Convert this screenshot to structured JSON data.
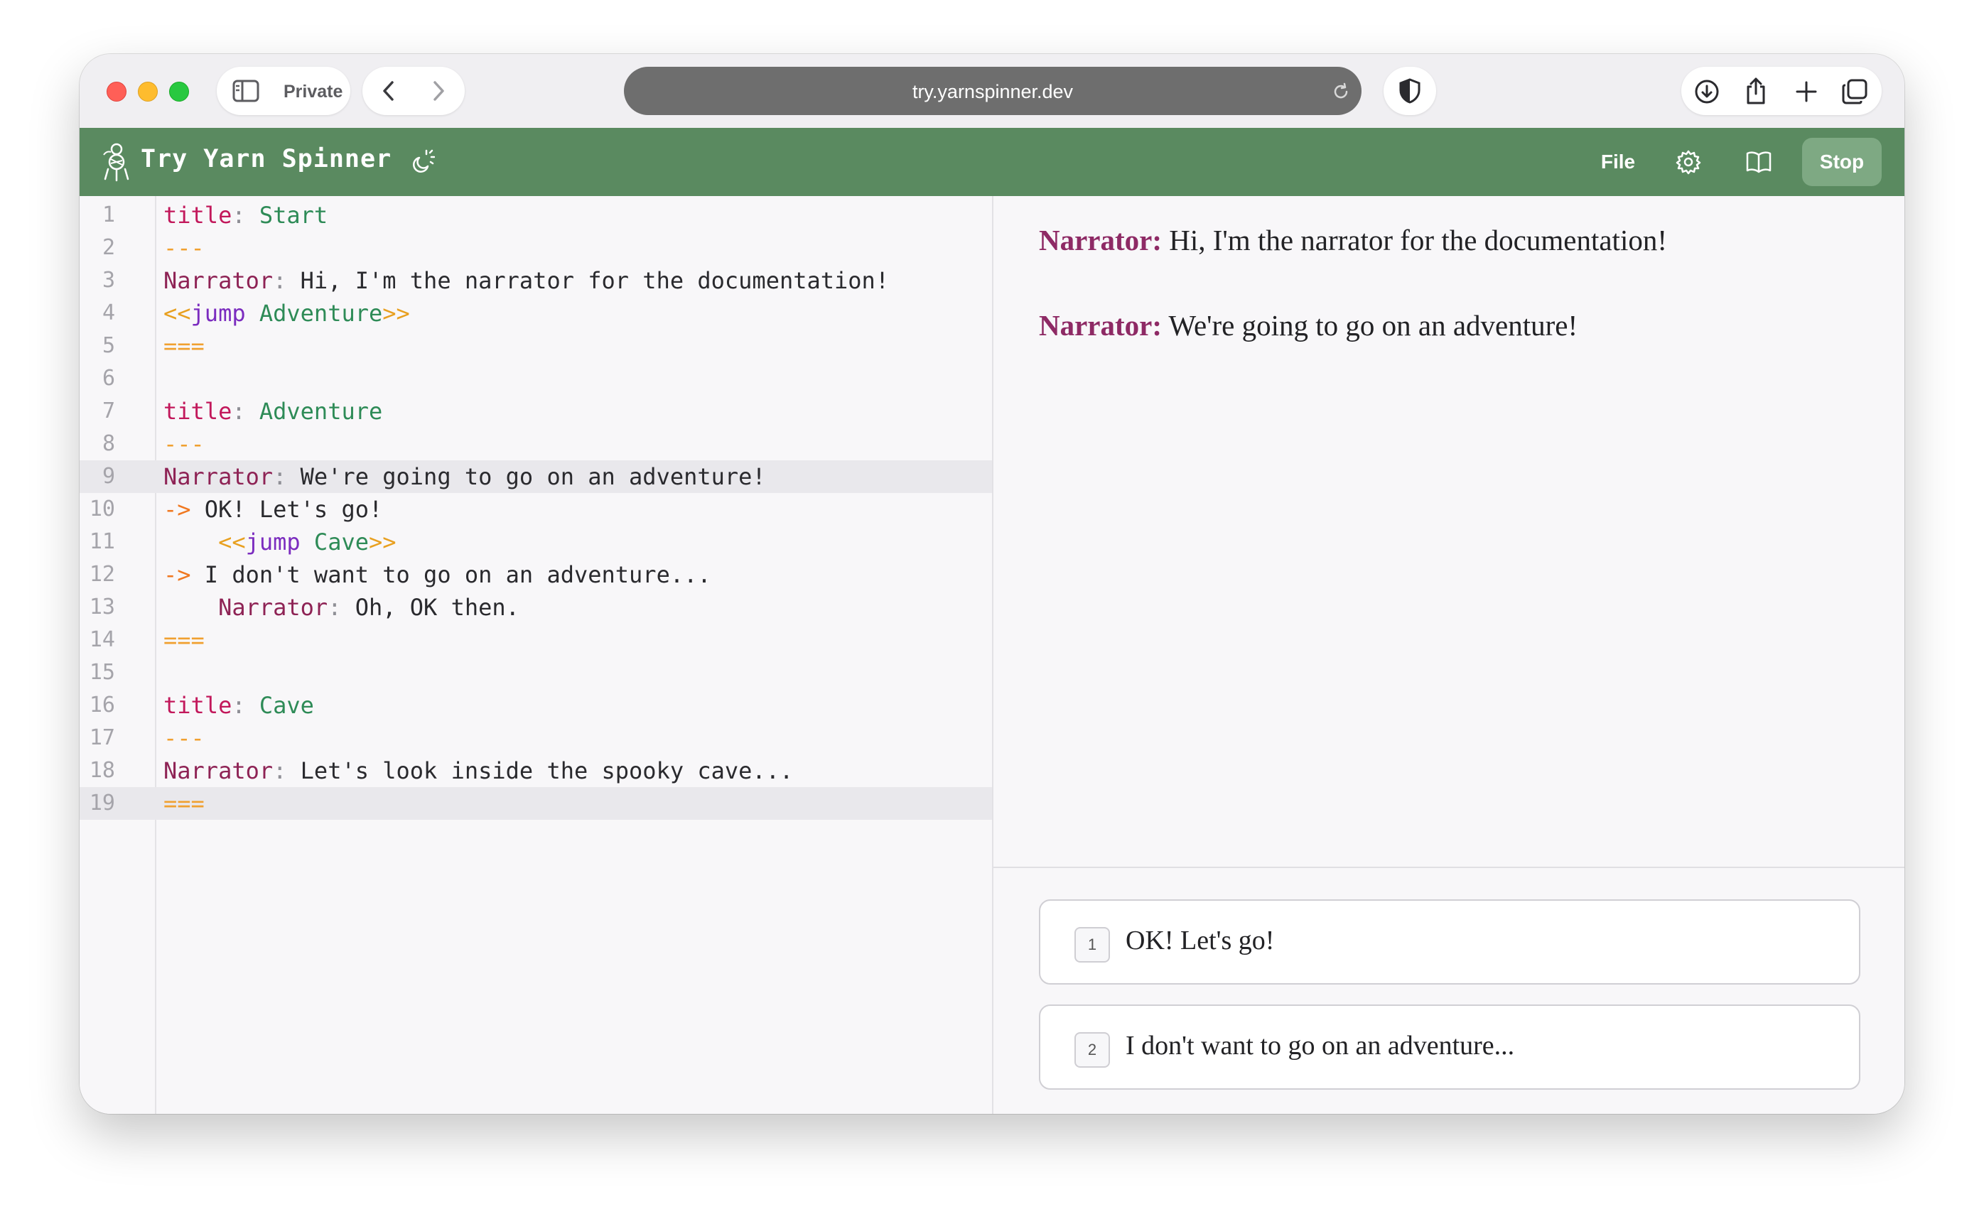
{
  "browser": {
    "private_label": "Private",
    "url": "try.yarnspinner.dev"
  },
  "app": {
    "title": "Try Yarn Spinner",
    "file_label": "File",
    "stop_label": "Stop",
    "header_color": "#5a8a60"
  },
  "editor": {
    "active_lines": [
      9,
      19
    ],
    "lines": [
      {
        "n": "1",
        "tokens": [
          {
            "t": "title",
            "c": "k-title"
          },
          {
            "t": ":",
            "c": "k-colon"
          },
          {
            "t": " Start",
            "c": "k-val"
          }
        ]
      },
      {
        "n": "2",
        "tokens": [
          {
            "t": "---",
            "c": "k-dash"
          }
        ]
      },
      {
        "n": "3",
        "tokens": [
          {
            "t": "Narrator",
            "c": "k-speaker"
          },
          {
            "t": ":",
            "c": "k-colon"
          },
          {
            "t": " Hi, I'm the narrator for the documentation!",
            "c": ""
          }
        ]
      },
      {
        "n": "4",
        "tokens": [
          {
            "t": "<<",
            "c": "k-brack"
          },
          {
            "t": "jump",
            "c": "k-cmd"
          },
          {
            "t": " Adventure",
            "c": "k-val"
          },
          {
            "t": ">>",
            "c": "k-brack"
          }
        ]
      },
      {
        "n": "5",
        "tokens": [
          {
            "t": "===",
            "c": "k-dash"
          }
        ]
      },
      {
        "n": "6",
        "tokens": []
      },
      {
        "n": "7",
        "tokens": [
          {
            "t": "title",
            "c": "k-title"
          },
          {
            "t": ":",
            "c": "k-colon"
          },
          {
            "t": " Adventure",
            "c": "k-val"
          }
        ]
      },
      {
        "n": "8",
        "tokens": [
          {
            "t": "---",
            "c": "k-dash"
          }
        ]
      },
      {
        "n": "9",
        "tokens": [
          {
            "t": "Narrator",
            "c": "k-speaker"
          },
          {
            "t": ":",
            "c": "k-colon"
          },
          {
            "t": " We're going to go on an adventure!",
            "c": ""
          }
        ]
      },
      {
        "n": "10",
        "tokens": [
          {
            "t": "->",
            "c": "k-arrow"
          },
          {
            "t": " OK! Let's go!",
            "c": ""
          }
        ]
      },
      {
        "n": "11",
        "tokens": [
          {
            "t": "    ",
            "c": ""
          },
          {
            "t": "<<",
            "c": "k-brack"
          },
          {
            "t": "jump",
            "c": "k-cmd"
          },
          {
            "t": " Cave",
            "c": "k-val"
          },
          {
            "t": ">>",
            "c": "k-brack"
          }
        ]
      },
      {
        "n": "12",
        "tokens": [
          {
            "t": "->",
            "c": "k-arrow"
          },
          {
            "t": " I don't want to go on an adventure...",
            "c": ""
          }
        ]
      },
      {
        "n": "13",
        "tokens": [
          {
            "t": "    ",
            "c": ""
          },
          {
            "t": "Narrator",
            "c": "k-speaker"
          },
          {
            "t": ":",
            "c": "k-colon"
          },
          {
            "t": " Oh, OK then.",
            "c": ""
          }
        ]
      },
      {
        "n": "14",
        "tokens": [
          {
            "t": "===",
            "c": "k-dash"
          }
        ]
      },
      {
        "n": "15",
        "tokens": []
      },
      {
        "n": "16",
        "tokens": [
          {
            "t": "title",
            "c": "k-title"
          },
          {
            "t": ":",
            "c": "k-colon"
          },
          {
            "t": " Cave",
            "c": "k-val"
          }
        ]
      },
      {
        "n": "17",
        "tokens": [
          {
            "t": "---",
            "c": "k-dash"
          }
        ]
      },
      {
        "n": "18",
        "tokens": [
          {
            "t": "Narrator",
            "c": "k-speaker"
          },
          {
            "t": ":",
            "c": "k-colon"
          },
          {
            "t": " Let's look inside the spooky cave...",
            "c": ""
          }
        ]
      },
      {
        "n": "19",
        "tokens": [
          {
            "t": "===",
            "c": "k-dash"
          }
        ]
      }
    ]
  },
  "preview": {
    "dialogue": [
      {
        "speaker": "Narrator:",
        "text": " Hi, I'm the narrator for the documentation!"
      },
      {
        "speaker": "Narrator:",
        "text": " We're going to go on an adventure!"
      }
    ],
    "options": [
      {
        "num": "1",
        "text": "OK! Let's go!"
      },
      {
        "num": "2",
        "text": "I don't want to go on an adventure..."
      }
    ]
  }
}
